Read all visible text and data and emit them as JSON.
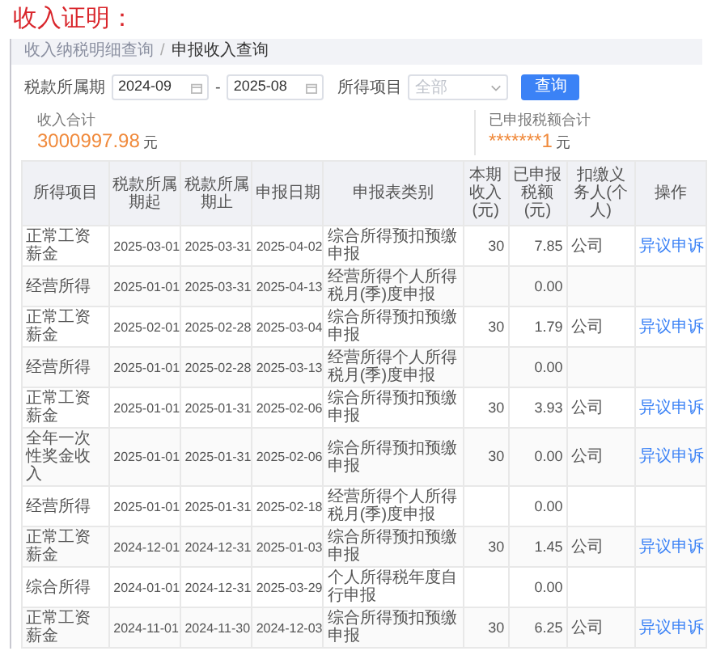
{
  "heading": "收入证明：",
  "breadcrumb_separator": "/",
  "breadcrumb": [
    {
      "label": "收入纳税明细查询",
      "selected": false
    },
    {
      "label": "申报收入查询",
      "selected": true
    }
  ],
  "filters": {
    "period_label": "税款所属期",
    "start": "2024-09",
    "separator": "-",
    "end": "2025-08",
    "item_label": "所得项目",
    "item_placeholder": "全部",
    "search_button": "查询"
  },
  "totals": [
    {
      "label": "收入合计",
      "value": "3000997.98",
      "unit": "元"
    },
    {
      "label": "已申报税额合计",
      "value": "*******1",
      "unit": "元"
    }
  ],
  "table": {
    "columns": [
      "所得项目",
      "税款所属期起",
      "税款所属期止",
      "申报日期",
      "申报表类别",
      "本期收入(元)",
      "已申报税额(元)",
      "扣缴义务人(个人)",
      "操作"
    ],
    "rows": [
      {
        "item": "正常工资薪金",
        "start": "2025-03-01",
        "end": "2025-03-31",
        "date": "2025-04-02",
        "form": "综合所得预扣预缴申报",
        "income": "30",
        "tax": "7.85",
        "payer": "公司",
        "action": "异议申诉"
      },
      {
        "item": "经营所得",
        "start": "2025-01-01",
        "end": "2025-03-31",
        "date": "2025-04-13",
        "form": "经营所得个人所得税月(季)度申报",
        "tax": "0.00"
      },
      {
        "item": "正常工资薪金",
        "start": "2025-02-01",
        "end": "2025-02-28",
        "date": "2025-03-04",
        "form": "综合所得预扣预缴申报",
        "income": "30",
        "tax": "1.79",
        "payer": "公司",
        "action": "异议申诉"
      },
      {
        "item": "经营所得",
        "start": "2025-01-01",
        "end": "2025-02-28",
        "date": "2025-03-13",
        "form": "经营所得个人所得税月(季)度申报",
        "tax": "0.00"
      },
      {
        "item": "正常工资薪金",
        "start": "2025-01-01",
        "end": "2025-01-31",
        "date": "2025-02-06",
        "form": "综合所得预扣预缴申报",
        "income": "30",
        "tax": "3.93",
        "payer": "公司",
        "action": "异议申诉"
      },
      {
        "item": "全年一次性奖金收入",
        "start": "2025-01-01",
        "end": "2025-01-31",
        "date": "2025-02-06",
        "form": "综合所得预扣预缴申报",
        "income": "30",
        "tax": "0.00",
        "payer": "公司",
        "action": "异议申诉"
      },
      {
        "item": "经营所得",
        "start": "2025-01-01",
        "end": "2025-01-31",
        "date": "2025-02-18",
        "form": "经营所得个人所得税月(季)度申报",
        "tax": "0.00"
      },
      {
        "item": "正常工资薪金",
        "start": "2024-12-01",
        "end": "2024-12-31",
        "date": "2025-01-03",
        "form": "综合所得预扣预缴申报",
        "income": "30",
        "tax": "1.45",
        "payer": "公司",
        "action": "异议申诉"
      },
      {
        "item": "综合所得",
        "start": "2024-01-01",
        "end": "2024-12-31",
        "date": "2025-03-29",
        "form": "个人所得税年度自行申报",
        "tax": "0.00"
      },
      {
        "item": "正常工资薪金",
        "start": "2024-11-01",
        "end": "2024-11-30",
        "date": "2024-12-03",
        "form": "综合所得预扣预缴申报",
        "income": "30",
        "tax": "6.25",
        "payer": "公司",
        "action": "异议申诉"
      }
    ]
  }
}
